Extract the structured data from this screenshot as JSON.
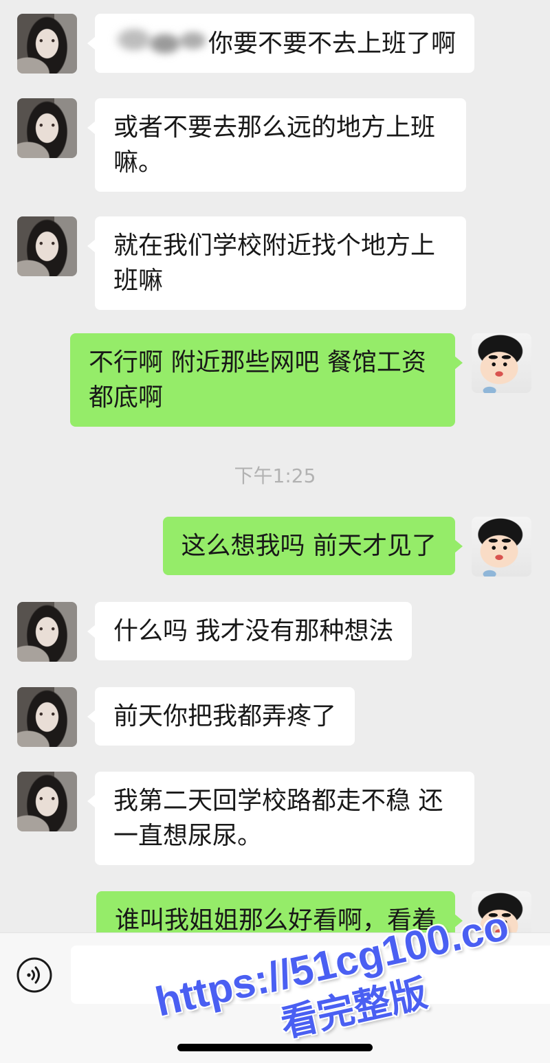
{
  "chat": {
    "messages": [
      {
        "from_me": false,
        "text": "你要不要不去上班了啊"
      },
      {
        "from_me": false,
        "text": "或者不要去那么远的地方上班嘛。"
      },
      {
        "from_me": false,
        "text": "就在我们学校附近找个地方上班嘛"
      },
      {
        "from_me": true,
        "text": "不行啊 附近那些网吧 餐馆工资都底啊"
      },
      {
        "from_me": true,
        "text": "这么想我吗 前天才见了"
      },
      {
        "from_me": false,
        "text": "什么吗 我才没有那种想法"
      },
      {
        "from_me": false,
        "text": "前天你把我都弄疼了"
      },
      {
        "from_me": false,
        "text": "我第二天回学校路都走不稳 还一直想尿尿。"
      },
      {
        "from_me": true,
        "text": "谁叫我姐姐那么好看啊，看着"
      }
    ],
    "timestamp": "下午1:25"
  },
  "input_bar": {
    "voice_icon": "voice-icon",
    "input_value": ""
  },
  "watermark": {
    "url": "https://51cg100.co",
    "caption": "看完整版"
  },
  "colors": {
    "background": "#ededed",
    "bubble_incoming": "#ffffff",
    "bubble_outgoing": "#95ec69",
    "text": "#181818",
    "timestamp": "#b2b2b2",
    "input_bar": "#f7f7f7",
    "watermark": "#4a5ff2"
  }
}
